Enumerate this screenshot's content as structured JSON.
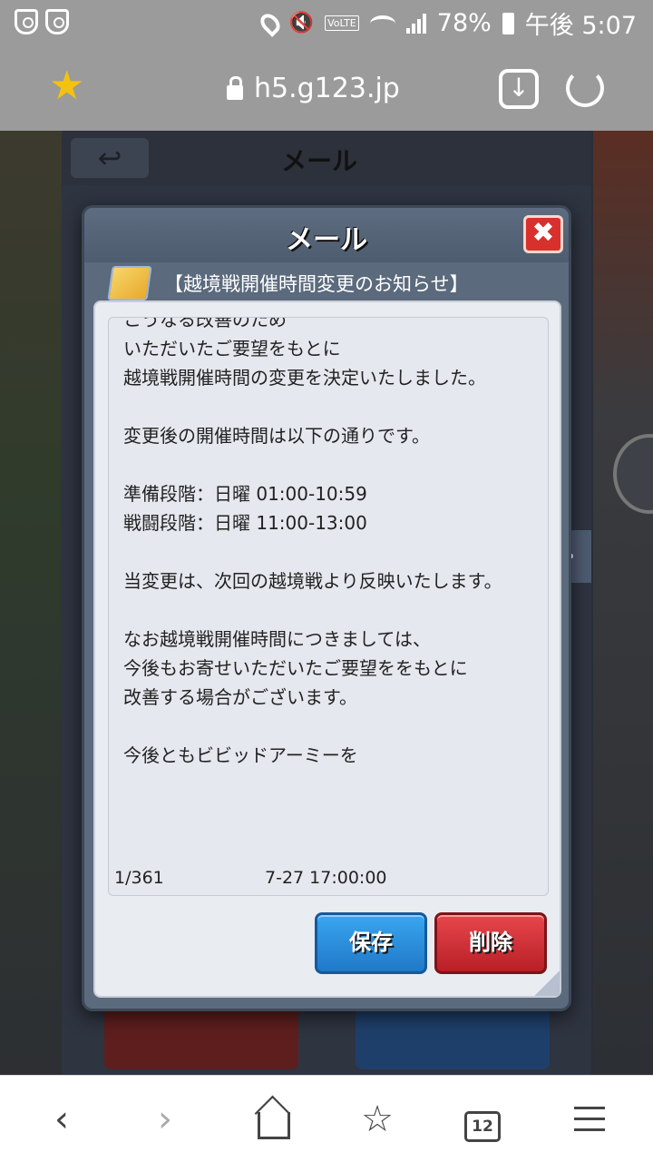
{
  "status_bar": {
    "battery": "78%",
    "time": "午後 5:07",
    "volte": "VoLTE"
  },
  "browser": {
    "url": "h5.g123.jp"
  },
  "game": {
    "background_title": "メール",
    "mail_dialog": {
      "title": "メール",
      "close_label": "✖",
      "subject": "【越境戦開催時間変更のお知らせ】",
      "body_lines": [
        "こうなる改善のため",
        "いただいたご要望をもとに",
        "越境戦開催時間の変更を決定いたしました。",
        "",
        "変更後の開催時間は以下の通りです。",
        "",
        "準備段階：日曜 01:00-10:59",
        "戦闘段階：日曜 11:00-13:00",
        "",
        "当変更は、次回の越境戦より反映いたします。",
        "",
        "なお越境戦開催時間につきましては、",
        "今後もお寄せいただいたご要望ををもとに",
        "改善する場合がございます。",
        "",
        "今後ともビビッドアーミーを"
      ],
      "page_count": "1/361",
      "date": "7-27 17:00:00",
      "save_label": "保存",
      "delete_label": "削除"
    }
  },
  "bottom_nav": {
    "tab_count": "12"
  }
}
